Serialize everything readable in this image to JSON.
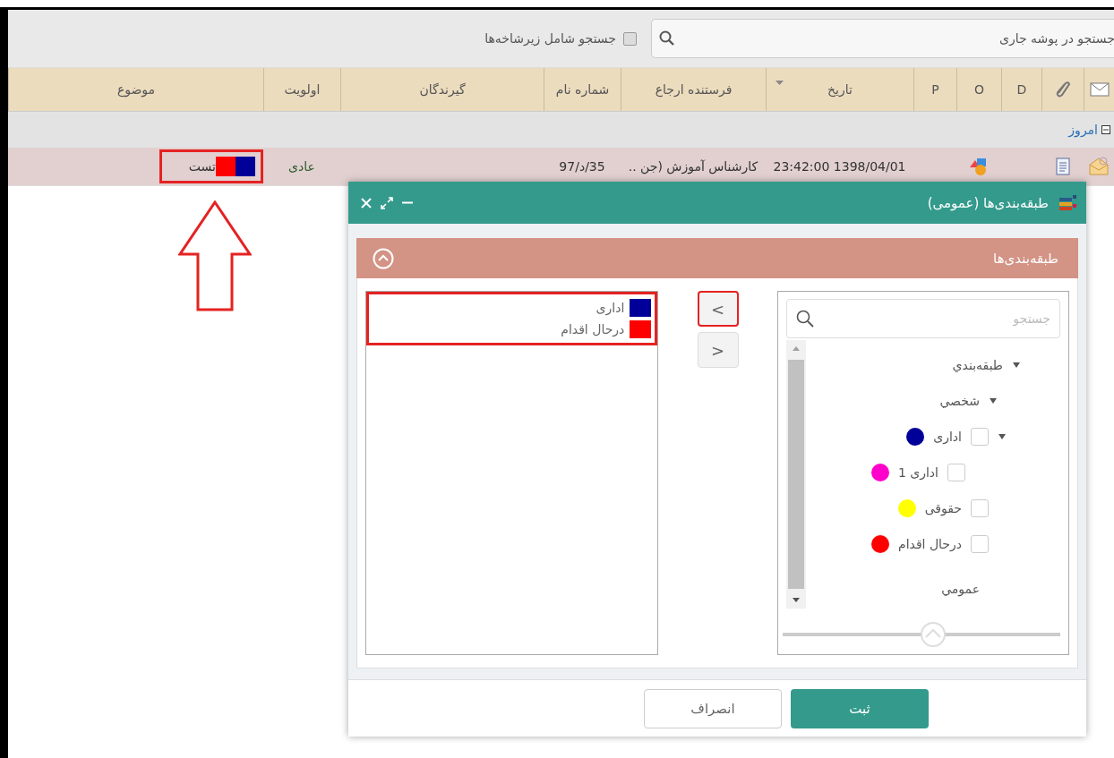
{
  "toolbar": {
    "search": {
      "placeholder": "جستجو در پوشه جاری"
    },
    "subfolders": {
      "label": "جستجو شامل زیرشاخه‌ها",
      "checked": false
    }
  },
  "table": {
    "columns": [
      {
        "kind": "mail-icon"
      },
      {
        "kind": "clip-icon"
      },
      {
        "kind": "text",
        "label": "D"
      },
      {
        "kind": "text",
        "label": "O"
      },
      {
        "kind": "text",
        "label": "P"
      },
      {
        "kind": "sort",
        "label": "تاریخ"
      },
      {
        "kind": "text",
        "label": "فرستنده ارجاع"
      },
      {
        "kind": "text",
        "label": "شماره نام"
      },
      {
        "kind": "text",
        "label": "گیرندگان"
      },
      {
        "kind": "text",
        "label": "اولویت"
      },
      {
        "kind": "text",
        "label": "موضوع"
      }
    ],
    "group": {
      "label": "امروز",
      "expanded": true
    },
    "rows": [
      {
        "date": "23:42:00 1398/04/01",
        "sender": "کارشناس آموزش (جن ..",
        "number": "97/د/35",
        "priority": "عادی",
        "subject": "تست",
        "tags": [
          {
            "color": "#000099"
          },
          {
            "color": "#ff0000"
          }
        ],
        "highlighted": true
      }
    ]
  },
  "dialog": {
    "title": "طبقه‌بندی‌ها (عمومی)",
    "panel_title": "طبقه‌بندی‌ها",
    "search": {
      "placeholder": "جستجو"
    },
    "tree": [
      {
        "kind": "group",
        "label": "طبقه‌بندي",
        "expanded": true,
        "children": [
          {
            "kind": "group",
            "label": "شخصي",
            "expanded": true,
            "children": [
              {
                "kind": "category",
                "label": "اداری",
                "color": "#000099",
                "checked": false,
                "expanded": true,
                "children": [
                  {
                    "kind": "category",
                    "label": "اداری 1",
                    "color": "#ff00cc",
                    "checked": false
                  }
                ]
              },
              {
                "kind": "category",
                "label": "حقوقی",
                "color": "#ffff00",
                "checked": false
              },
              {
                "kind": "category",
                "label": "درحال اقدام",
                "color": "#ff0000",
                "checked": false
              }
            ]
          },
          {
            "kind": "plain",
            "label": "عمومي"
          }
        ]
      }
    ],
    "move_buttons": [
      {
        "label": "<",
        "highlighted": true
      },
      {
        "label": ">",
        "highlighted": false
      }
    ],
    "selected": {
      "highlighted": true,
      "items": [
        {
          "label": "اداری",
          "color": "#000099"
        },
        {
          "label": "درحال اقدام",
          "color": "#ff0000"
        }
      ]
    },
    "buttons": [
      {
        "kind": "primary",
        "label": "ثبت"
      },
      {
        "kind": "secondary",
        "label": "انصراف"
      }
    ]
  }
}
